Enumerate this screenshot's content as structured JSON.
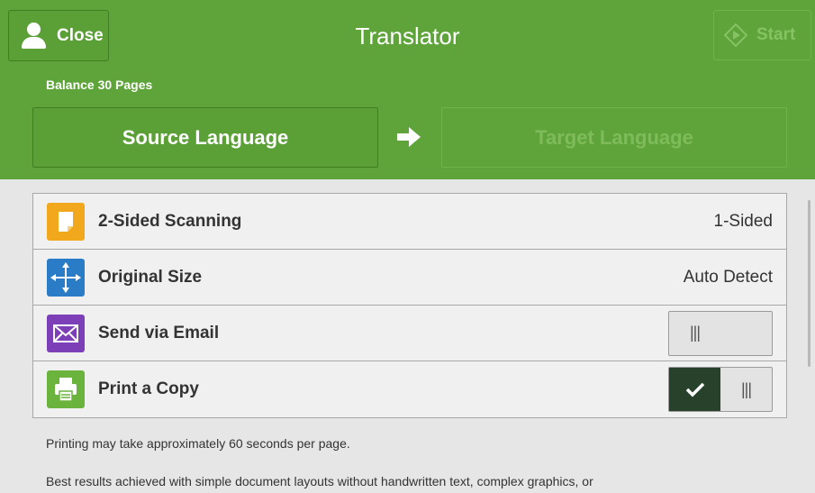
{
  "header": {
    "close_label": "Close",
    "title": "Translator",
    "start_label": "Start",
    "balance": "Balance 30 Pages",
    "source_language_label": "Source Language",
    "target_language_label": "Target Language"
  },
  "settings": [
    {
      "label": "2-Sided Scanning",
      "value": "1-Sided",
      "icon": "document-icon"
    },
    {
      "label": "Original Size",
      "value": "Auto Detect",
      "icon": "resize-arrows-icon"
    },
    {
      "label": "Send via Email",
      "toggle": false,
      "icon": "envelope-icon"
    },
    {
      "label": "Print a Copy",
      "toggle": true,
      "icon": "printer-icon"
    }
  ],
  "notes": {
    "line1": "Printing may take approximately 60 seconds per page.",
    "line2": "Best results achieved with simple document layouts without handwritten text, complex graphics, or"
  },
  "colors": {
    "header_green": "#5ea43a",
    "toggle_on": "#27412b"
  }
}
